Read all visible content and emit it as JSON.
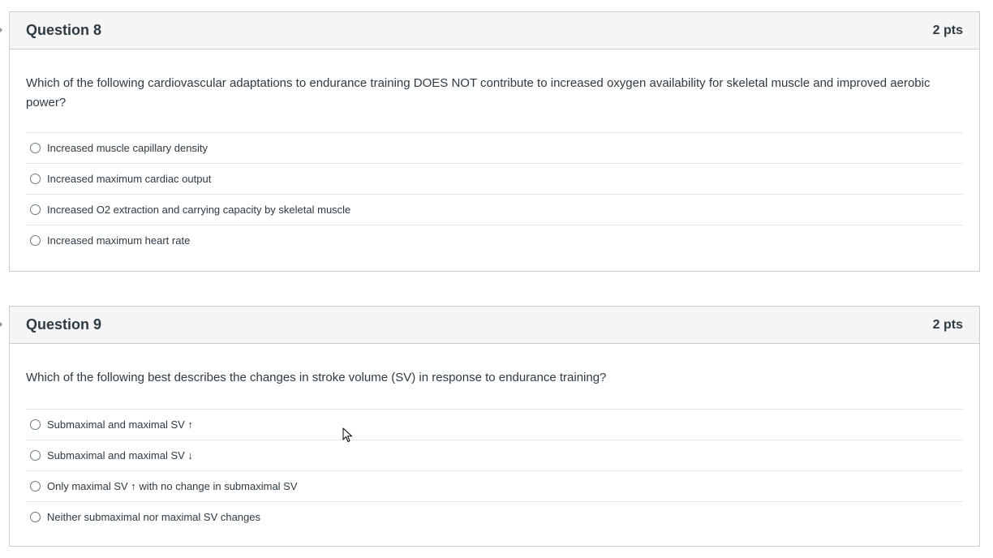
{
  "questions": [
    {
      "title": "Question 8",
      "points": "2 pts",
      "text": "Which of the following cardiovascular adaptations to endurance training DOES NOT contribute to increased oxygen availability for skeletal muscle and improved aerobic power?",
      "answers": [
        "Increased muscle capillary density",
        "Increased maximum cardiac output",
        "Increased O2 extraction and carrying capacity by skeletal muscle",
        "Increased maximum heart rate"
      ]
    },
    {
      "title": "Question 9",
      "points": "2 pts",
      "text": "Which of the following best describes the changes in stroke volume (SV) in response to endurance training?",
      "answers": [
        "Submaximal and maximal SV ↑",
        "Submaximal and maximal SV ↓",
        "Only maximal SV ↑ with no change in submaximal SV",
        "Neither submaximal nor maximal SV changes"
      ]
    }
  ],
  "icons": {
    "radio": "radio-button-icon",
    "cursor": "mouse-pointer-icon"
  }
}
